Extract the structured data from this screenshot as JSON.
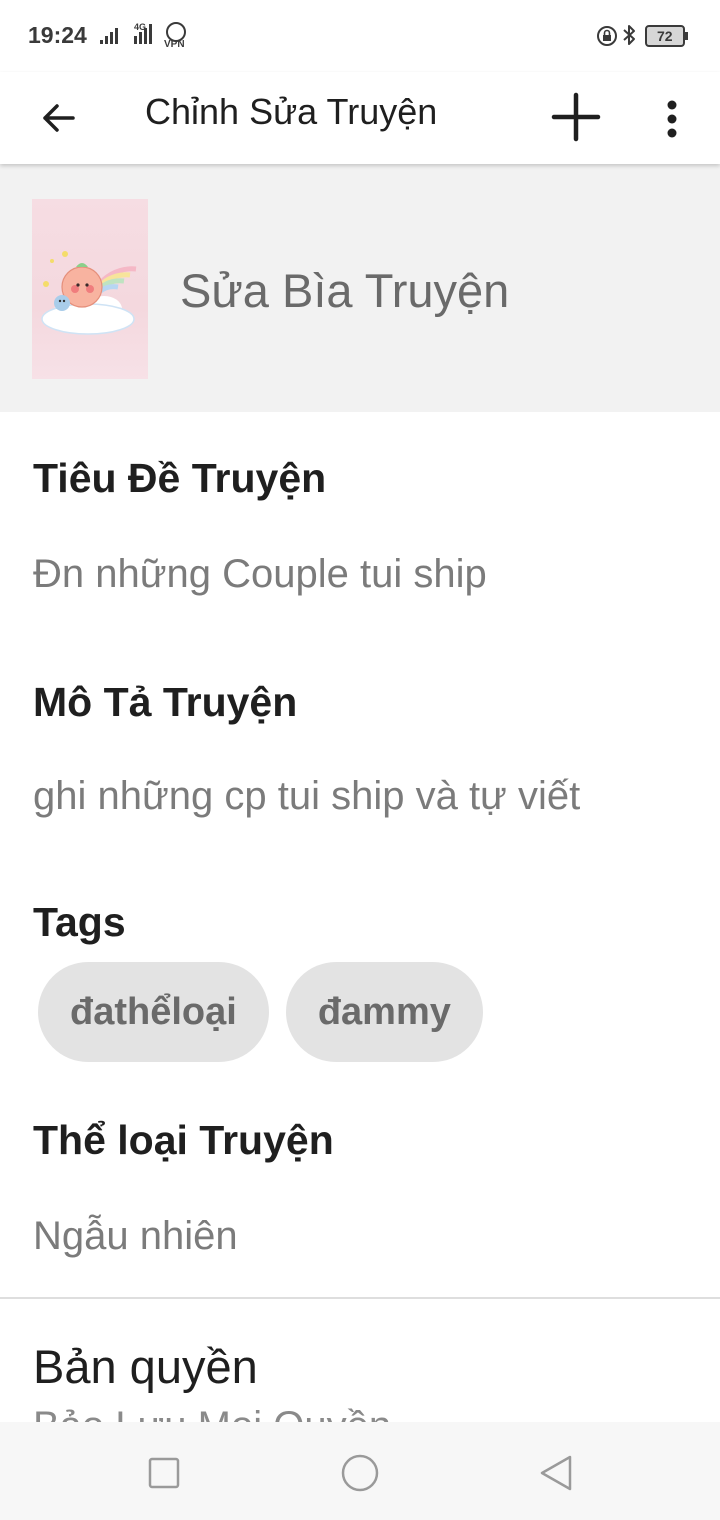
{
  "status_bar": {
    "time": "19:24",
    "network_label": "4G",
    "vpn_label": "VPN",
    "battery": "72",
    "icons": [
      "signal-icon",
      "network-4g-icon",
      "vpn-icon",
      "lock-rotation-icon",
      "bluetooth-icon",
      "battery-icon"
    ]
  },
  "app_bar": {
    "title": "Chỉnh Sửa Truyện",
    "back_icon": "arrow-left-icon",
    "add_icon": "plus-icon",
    "more_icon": "more-vertical-icon"
  },
  "cover": {
    "label": "Sửa Bìa Truyện"
  },
  "title_field": {
    "label": "Tiêu Đề Truyện",
    "value": "Đn những Couple tui ship"
  },
  "description_field": {
    "label": "Mô Tả Truyện",
    "value": "ghi những cp tui ship và tự viết"
  },
  "tags_section": {
    "label": "Tags",
    "items": [
      "đathểloại",
      "đammy"
    ]
  },
  "genre_field": {
    "label": "Thể loại Truyện",
    "value": "Ngẫu nhiên"
  },
  "copyright_field": {
    "label": "Bản quyền",
    "value": "Bảo Lưu Mọi Quyền"
  },
  "nav_bar": {
    "icons": [
      "recent-apps-icon",
      "home-icon",
      "back-triangle-icon"
    ]
  }
}
